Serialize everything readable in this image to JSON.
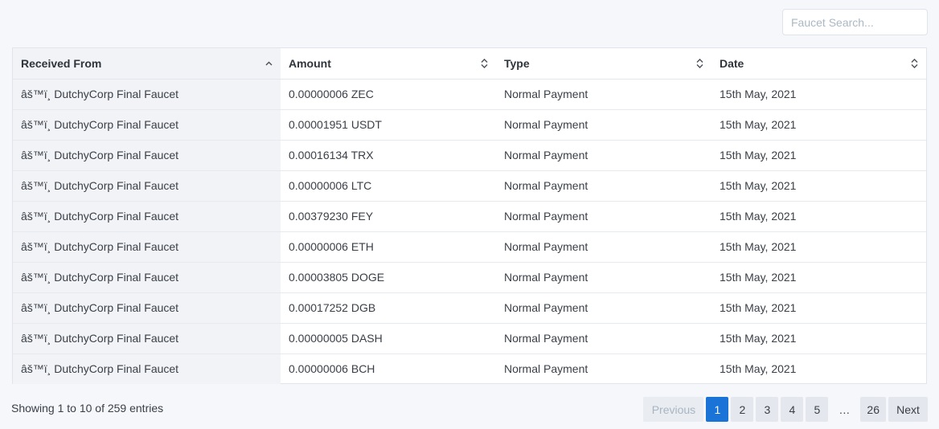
{
  "search": {
    "placeholder": "Faucet Search..."
  },
  "table": {
    "headers": [
      "Received From",
      "Amount",
      "Type",
      "Date"
    ],
    "rows": [
      [
        "âš™ï¸ DutchyCorp Final Faucet",
        "0.00000006 ZEC",
        "Normal Payment",
        "15th May, 2021"
      ],
      [
        "âš™ï¸ DutchyCorp Final Faucet",
        "0.00001951 USDT",
        "Normal Payment",
        "15th May, 2021"
      ],
      [
        "âš™ï¸ DutchyCorp Final Faucet",
        "0.00016134 TRX",
        "Normal Payment",
        "15th May, 2021"
      ],
      [
        "âš™ï¸ DutchyCorp Final Faucet",
        "0.00000006 LTC",
        "Normal Payment",
        "15th May, 2021"
      ],
      [
        "âš™ï¸ DutchyCorp Final Faucet",
        "0.00379230 FEY",
        "Normal Payment",
        "15th May, 2021"
      ],
      [
        "âš™ï¸ DutchyCorp Final Faucet",
        "0.00000006 ETH",
        "Normal Payment",
        "15th May, 2021"
      ],
      [
        "âš™ï¸ DutchyCorp Final Faucet",
        "0.00003805 DOGE",
        "Normal Payment",
        "15th May, 2021"
      ],
      [
        "âš™ï¸ DutchyCorp Final Faucet",
        "0.00017252 DGB",
        "Normal Payment",
        "15th May, 2021"
      ],
      [
        "âš™ï¸ DutchyCorp Final Faucet",
        "0.00000005 DASH",
        "Normal Payment",
        "15th May, 2021"
      ],
      [
        "âš™ï¸ DutchyCorp Final Faucet",
        "0.00000006 BCH",
        "Normal Payment",
        "15th May, 2021"
      ]
    ]
  },
  "info": "Showing 1 to 10 of 259 entries",
  "pagination": {
    "previous": "Previous",
    "pages": [
      "1",
      "2",
      "3",
      "4",
      "5"
    ],
    "ellipsis": "…",
    "last": "26",
    "next": "Next"
  },
  "colors": {
    "active_page": "#1a73d6",
    "sorted_column": "#f1f3f6"
  }
}
